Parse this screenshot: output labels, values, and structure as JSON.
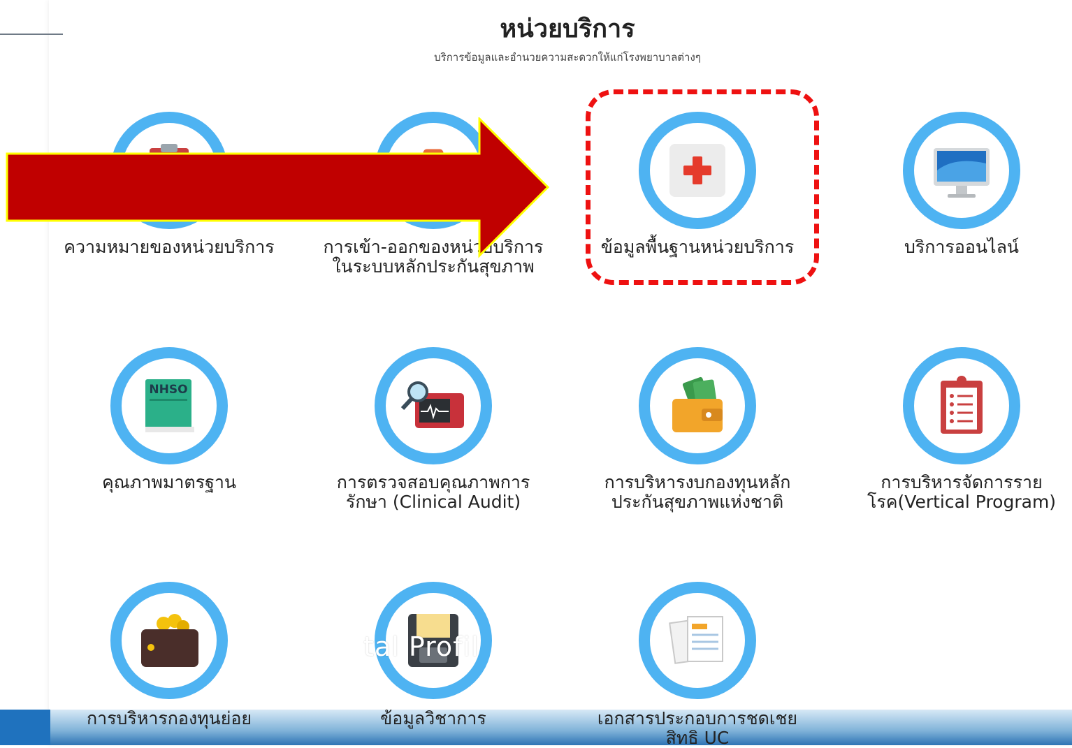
{
  "header": {
    "title": "หน่วยบริการ",
    "subtitle": "บริการข้อมูลและอำนวยความสะดวกให้แก่โรงพยาบาลต่างๆ"
  },
  "tiles": [
    {
      "icon": "clipboard-icon",
      "line1": "ความหมายของหน่วยบริการ",
      "line2": ""
    },
    {
      "icon": "first-aid-kit-icon",
      "line1": "การเข้า-ออกของหน่วยบริการ",
      "line2": "ในระบบหลักประกันสุขภาพ"
    },
    {
      "icon": "red-cross-icon",
      "line1": "ข้อมูลพื้นฐานหน่วยบริการ",
      "line2": ""
    },
    {
      "icon": "computer-monitor-icon",
      "line1": "บริการออนไลน์",
      "line2": ""
    },
    {
      "icon": "nhso-book-icon",
      "line1": "คุณภาพมาตรฐาน",
      "line2": "",
      "badge": "NHSO"
    },
    {
      "icon": "monitor-magnifier-icon",
      "line1": "การตรวจสอบคุณภาพการ",
      "line2": "รักษา (Clinical Audit)"
    },
    {
      "icon": "wallet-money-icon",
      "line1": "การบริหารงบกองทุนหลัก",
      "line2": "ประกันสุขภาพแห่งชาติ"
    },
    {
      "icon": "checklist-clipboard-icon",
      "line1": "การบริหารจัดการราย",
      "line2": "โรค(Vertical Program)"
    },
    {
      "icon": "coin-wallet-icon",
      "line1": "การบริหารกองทุนย่อย",
      "line2": ""
    },
    {
      "icon": "floppy-disk-icon",
      "line1": "ข้อมูลวิชาการ",
      "line2": ""
    },
    {
      "icon": "documents-icon",
      "line1": "เอกสารประกอบการชดเชย",
      "line2": "สิทธิ UC"
    }
  ],
  "overlay": {
    "text": "tal Profil"
  },
  "colors": {
    "ring": "#4eb3f2",
    "arrow": "#c00000",
    "arrow_outline": "#ffff00",
    "highlight": "#ee1111"
  }
}
